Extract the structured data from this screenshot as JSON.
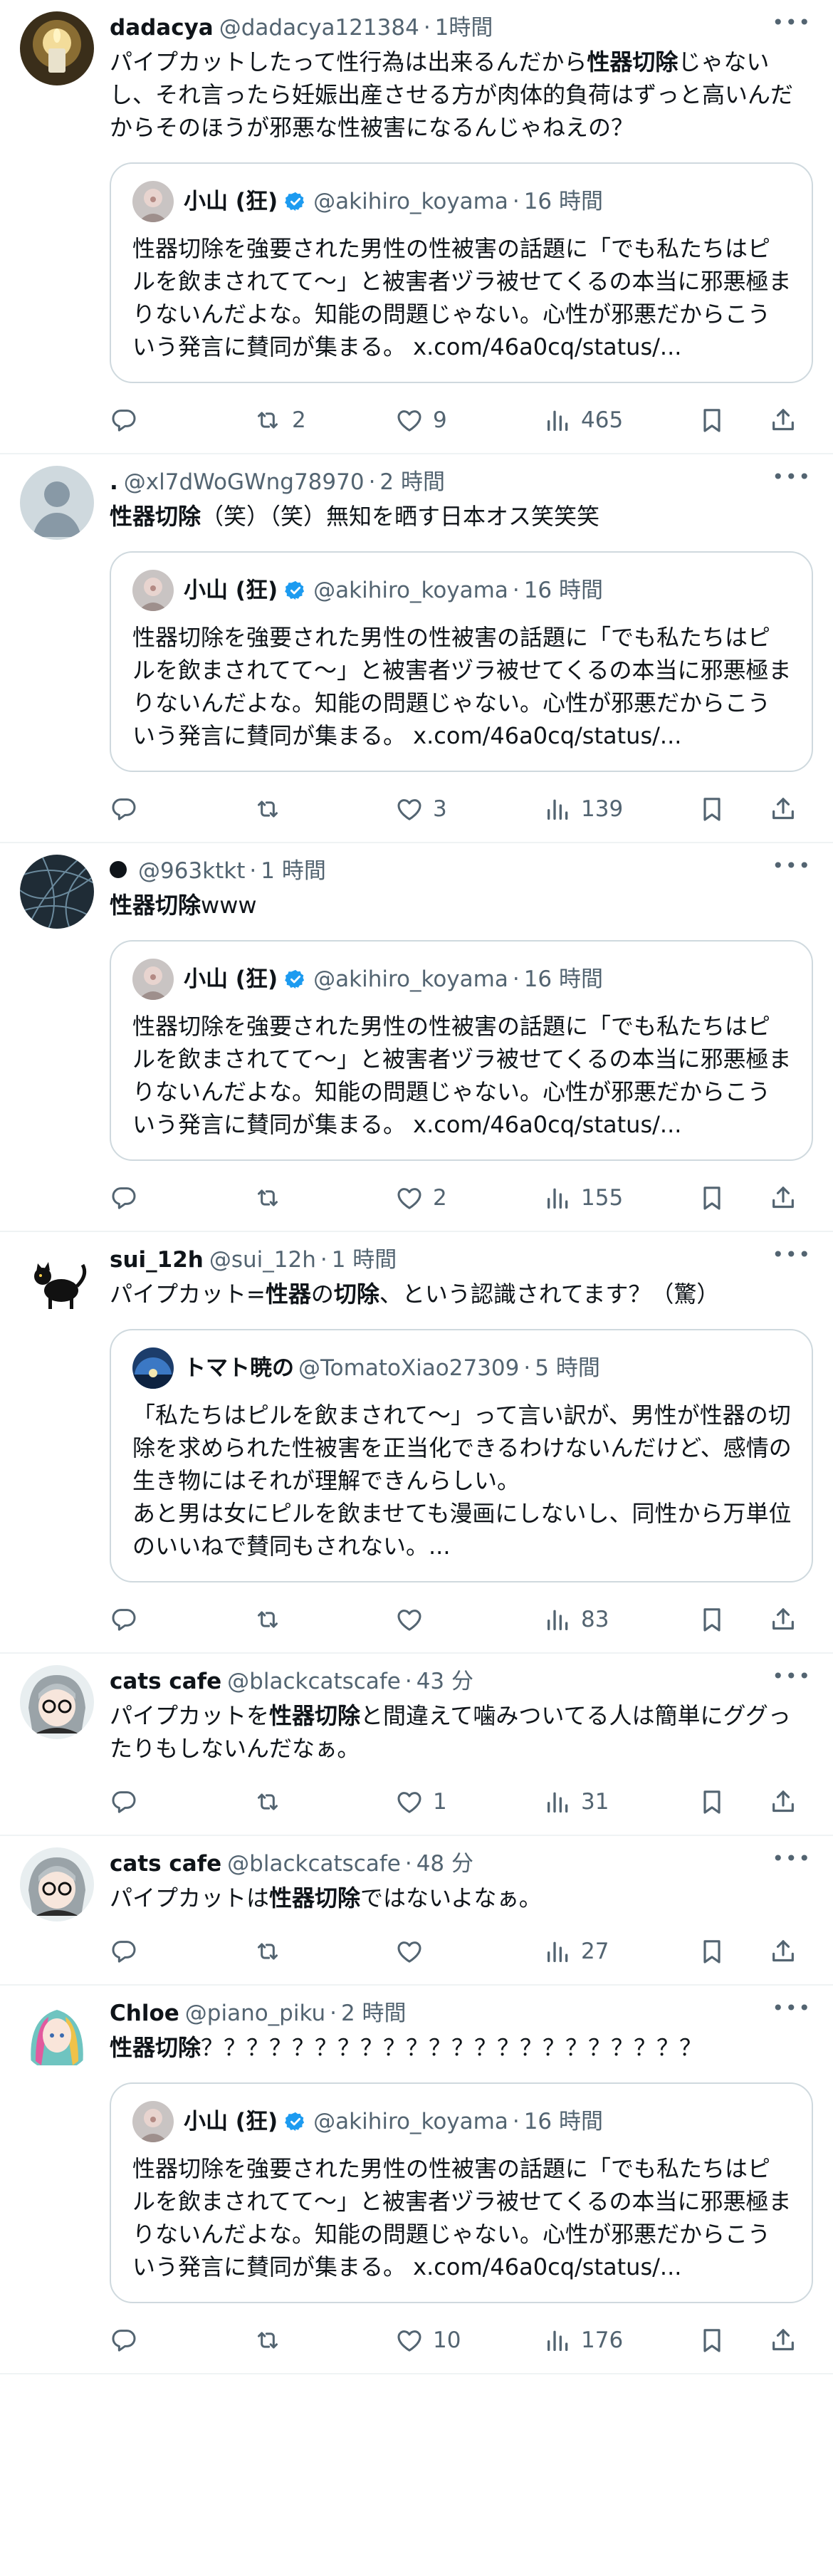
{
  "tweets": [
    {
      "name": "dadacya",
      "handle": "@dadacya121384",
      "dot": "·",
      "time": "1時間",
      "avatar": "candle-avatar",
      "text": [
        {
          "t": "パイプカットしたって性行為は出来るんだから",
          "b": false
        },
        {
          "t": "性器切除",
          "b": true
        },
        {
          "t": "じゃないし、それ言ったら妊娠出産させる方が肉体的負荷はずっと高いんだからそのほうが邪悪な性被害になるんじゃねえの？",
          "b": false
        }
      ],
      "quote": {
        "name": "小山 (狂)",
        "handle": "@akihiro_koyama",
        "dot": "·",
        "time": "16 時間",
        "verified": true,
        "text": "性器切除を強要された男性の性被害の話題に「でも私たちはピルを飲まされてて〜」と被害者ヅラ被せてくるの本当に邪悪極まりないんだよな。知能の問題じゃない。心性が邪悪だからこういう発言に賛同が集まる。 x.com/46a0cq/status/..."
      },
      "actions": {
        "replies": "",
        "retweets": "2",
        "likes": "9",
        "views": "465"
      }
    },
    {
      "name": ".",
      "handle": "@xl7dWoGWng78970",
      "dot": "·",
      "time": "2 時間",
      "avatar": "default-avatar",
      "text": [
        {
          "t": "性器切除",
          "b": true
        },
        {
          "t": "（笑）（笑）無知を晒す日本オス笑笑笑",
          "b": false
        }
      ],
      "quote": {
        "name": "小山 (狂)",
        "handle": "@akihiro_koyama",
        "dot": "·",
        "time": "16 時間",
        "verified": true,
        "text": "性器切除を強要された男性の性被害の話題に「でも私たちはピルを飲まされてて〜」と被害者ヅラ被せてくるの本当に邪悪極まりないんだよな。知能の問題じゃない。心性が邪悪だからこういう発言に賛同が集まる。 x.com/46a0cq/status/..."
      },
      "actions": {
        "replies": "",
        "retweets": "",
        "likes": "3",
        "views": "139"
      }
    },
    {
      "name": "",
      "dotname": true,
      "handle": "@963ktkt",
      "dot": "·",
      "time": "1 時間",
      "avatar": "wire-avatar",
      "text": [
        {
          "t": "性器切除",
          "b": true
        },
        {
          "t": "www",
          "b": false
        }
      ],
      "quote": {
        "name": "小山 (狂)",
        "handle": "@akihiro_koyama",
        "dot": "·",
        "time": "16 時間",
        "verified": true,
        "text": "性器切除を強要された男性の性被害の話題に「でも私たちはピルを飲まされてて〜」と被害者ヅラ被せてくるの本当に邪悪極まりないんだよな。知能の問題じゃない。心性が邪悪だからこういう発言に賛同が集まる。 x.com/46a0cq/status/..."
      },
      "actions": {
        "replies": "",
        "retweets": "",
        "likes": "2",
        "views": "155"
      }
    },
    {
      "name": "sui_12h",
      "handle": "@sui_12h",
      "dot": "·",
      "time": "1 時間",
      "avatar": "cat-avatar",
      "text": [
        {
          "t": "パイプカット=",
          "b": false
        },
        {
          "t": "性器",
          "b": true
        },
        {
          "t": "の",
          "b": false
        },
        {
          "t": "切除",
          "b": true
        },
        {
          "t": "、という認識されてます？（驚）",
          "b": false
        }
      ],
      "quote": {
        "name": "トマト暁の",
        "handle": "@TomatoXiao27309",
        "dot": "·",
        "time": "5 時間",
        "verified": false,
        "text": "「私たちはピルを飲まされて〜」って言い訳が、男性が性器の切除を求められた性被害を正当化できるわけないんだけど、感情の生き物にはそれが理解できんらしい。\nあと男は女にピルを飲ませても漫画にしないし、同性から万単位のいいねで賛同もされない。..."
      },
      "actions": {
        "replies": "",
        "retweets": "",
        "likes": "",
        "views": "83"
      }
    },
    {
      "name": "cats cafe",
      "handle": "@blackcatscafe",
      "dot": "·",
      "time": "43 分",
      "avatar": "anime-avatar",
      "text": [
        {
          "t": "パイプカットを",
          "b": false
        },
        {
          "t": "性器切除",
          "b": true
        },
        {
          "t": "と間違えて噛みついてる人は簡単にググったりもしないんだなぁ。",
          "b": false
        }
      ],
      "quote": null,
      "actions": {
        "replies": "",
        "retweets": "",
        "likes": "1",
        "views": "31"
      }
    },
    {
      "name": "cats cafe",
      "handle": "@blackcatscafe",
      "dot": "·",
      "time": "48 分",
      "avatar": "anime-avatar",
      "text": [
        {
          "t": "パイプカットは",
          "b": false
        },
        {
          "t": "性器切除",
          "b": true
        },
        {
          "t": "ではないよなぁ。",
          "b": false
        }
      ],
      "quote": null,
      "actions": {
        "replies": "",
        "retweets": "",
        "likes": "",
        "views": "27"
      }
    },
    {
      "name": "Chloe",
      "handle": "@piano_piku",
      "dot": "·",
      "time": "2 時間",
      "avatar": "chloe-avatar",
      "text": [
        {
          "t": "性器切除",
          "b": true
        },
        {
          "t": "？？？？？？？？？？？？？？？？？？？？？？",
          "b": false
        }
      ],
      "quote": {
        "name": "小山 (狂)",
        "handle": "@akihiro_koyama",
        "dot": "·",
        "time": "16 時間",
        "verified": true,
        "text": "性器切除を強要された男性の性被害の話題に「でも私たちはピルを飲まされてて〜」と被害者ヅラ被せてくるの本当に邪悪極まりないんだよな。知能の問題じゃない。心性が邪悪だからこういう発言に賛同が集まる。 x.com/46a0cq/status/..."
      },
      "actions": {
        "replies": "",
        "retweets": "",
        "likes": "10",
        "views": "176"
      }
    }
  ],
  "colors": {
    "text": "#0f1419",
    "muted": "#536471",
    "border": "#cfd9de",
    "divider": "#eff3f4",
    "verified": "#1d9bf0"
  }
}
